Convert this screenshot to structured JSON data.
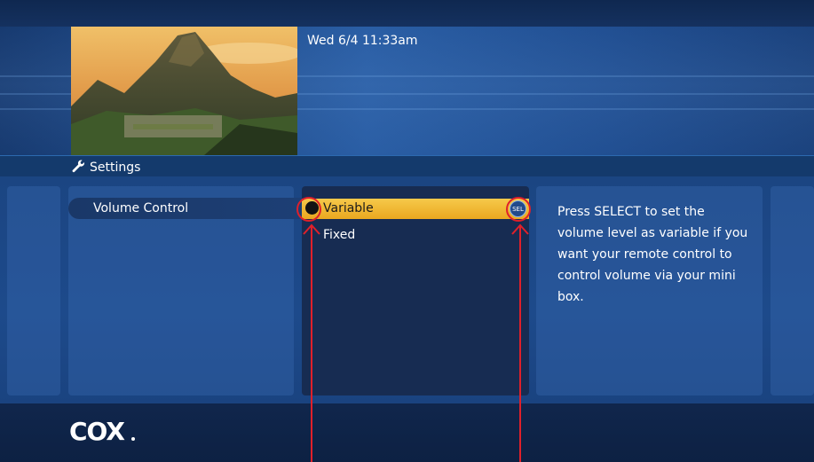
{
  "header": {
    "datetime": "Wed 6/4  11:33am"
  },
  "breadcrumb": {
    "title": "Settings",
    "icon": "wrench-icon"
  },
  "menu": {
    "selected_item": "Volume Control"
  },
  "options": {
    "items": [
      {
        "label": "Variable",
        "selected": true
      },
      {
        "label": "Fixed",
        "selected": false
      }
    ],
    "select_hint": "SEL"
  },
  "help": {
    "text": "Press SELECT to set the volume level as variable if you want your remote control to control volume via your mini box."
  },
  "footer": {
    "logo": "COX"
  },
  "colors": {
    "highlight": "#f0b935",
    "annotation": "#e0202a",
    "background": "#1c3f78"
  }
}
